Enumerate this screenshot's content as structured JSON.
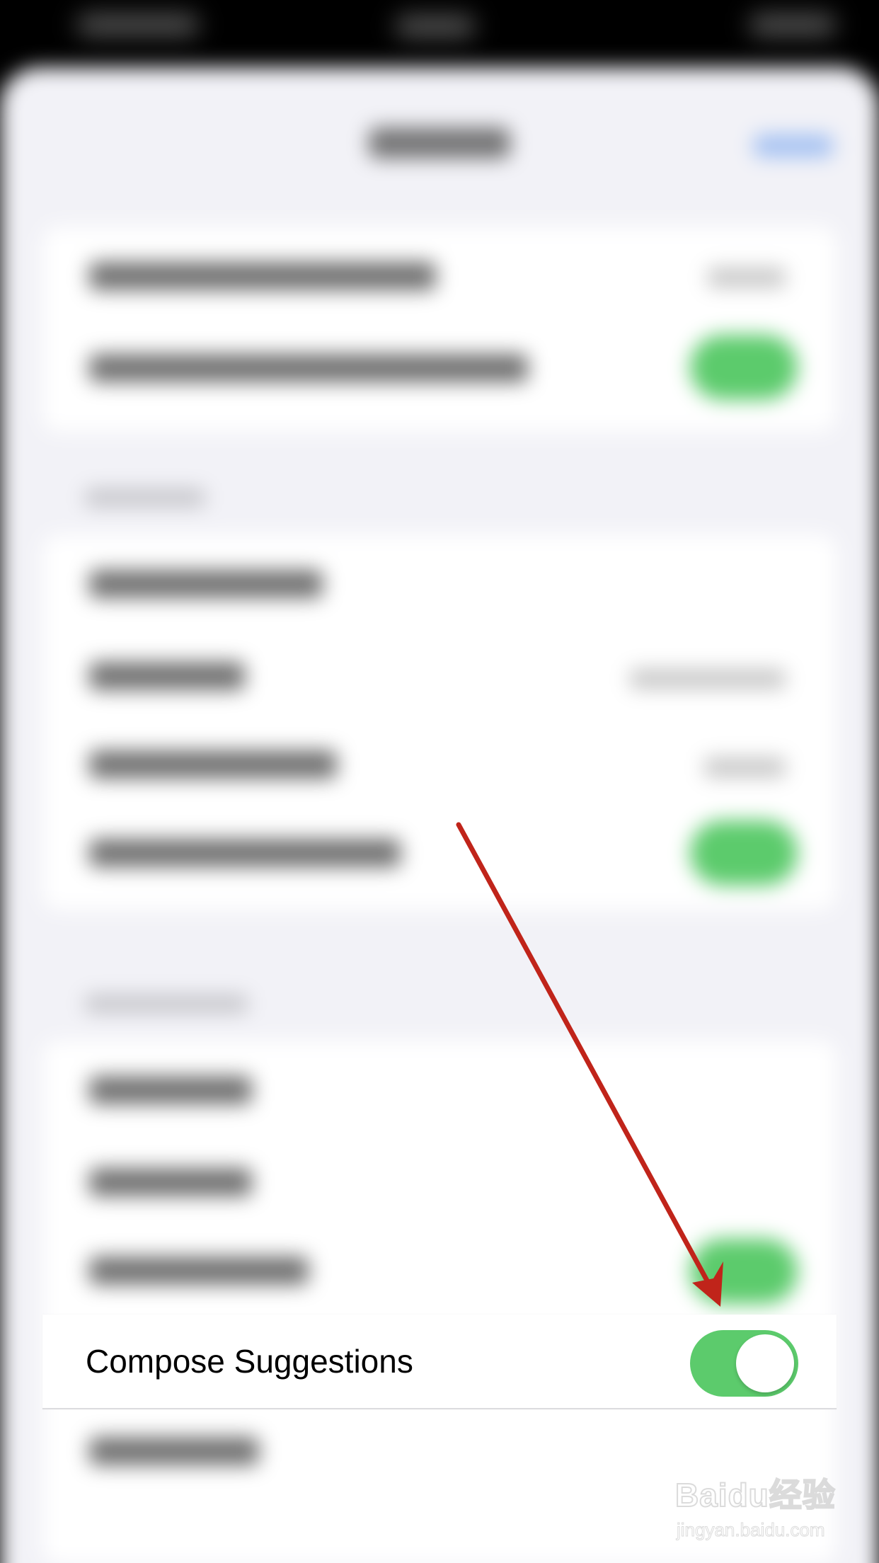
{
  "compose_row": {
    "label": "Compose Suggestions",
    "toggle_on": true
  },
  "colors": {
    "toggle_on": "#5ccb6c",
    "annotation_arrow": "#c0241a",
    "background": "#f2f2f7"
  },
  "watermark": {
    "logo": "Baidu经验",
    "url": "jingyan.baidu.com"
  }
}
